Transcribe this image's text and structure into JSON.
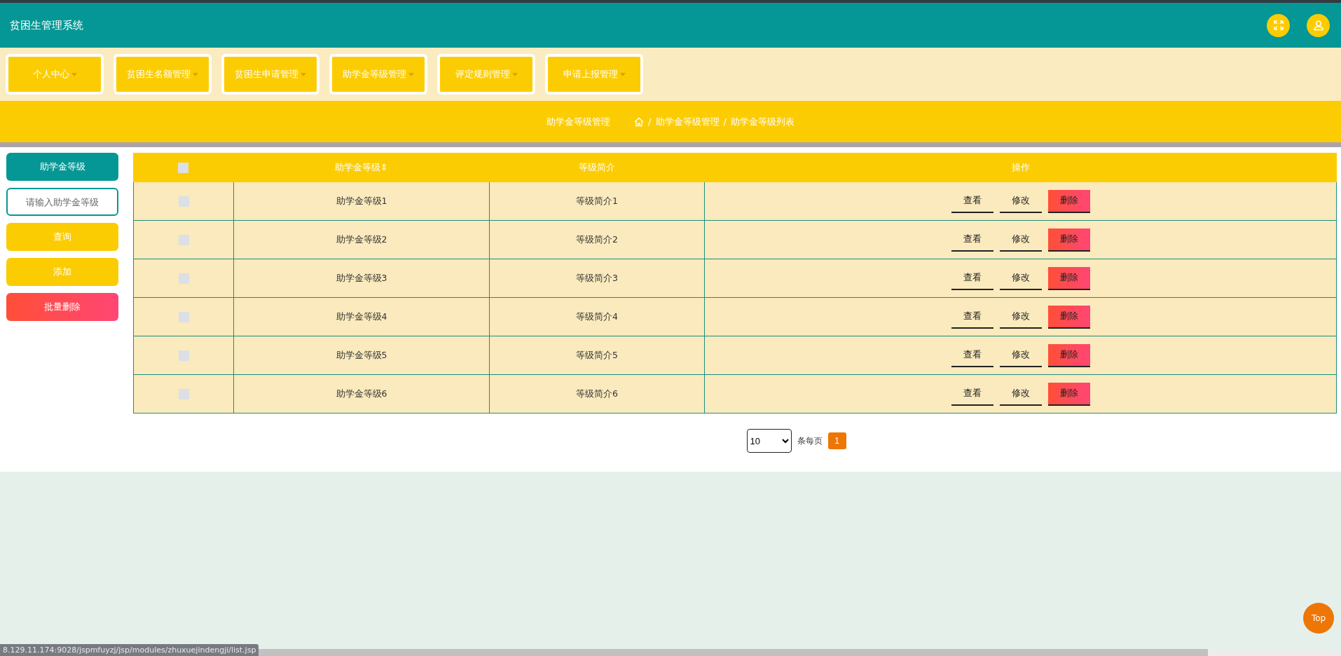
{
  "header": {
    "title": "贫困生管理系统"
  },
  "nav": [
    {
      "label": "个人中心"
    },
    {
      "label": "贫困生名额管理"
    },
    {
      "label": "贫困生申请管理"
    },
    {
      "label": "助学金等级管理"
    },
    {
      "label": "评定规则管理"
    },
    {
      "label": "申请上报管理"
    }
  ],
  "breadcrumb": {
    "title": "助学金等级管理",
    "path": [
      "助学金等级管理",
      "助学金等级列表"
    ],
    "separator": "/"
  },
  "sidebar": {
    "heading": "助学金等级",
    "search": {
      "placeholder": "请输入助学金等级"
    },
    "buttons": [
      {
        "label": "查询",
        "kind": "primary"
      },
      {
        "label": "添加",
        "kind": "primary"
      },
      {
        "label": "批量删除",
        "kind": "danger"
      }
    ]
  },
  "table": {
    "columns": [
      "助学金等级",
      "等级简介",
      "操作"
    ],
    "sort_mark": "⇕",
    "select_all_checked": false,
    "rows": [
      {
        "grade": "助学金等级1",
        "intro": "等级简介1",
        "checked": false,
        "actions": [
          {
            "label": "查看",
            "kind": "plain"
          },
          {
            "label": "修改",
            "kind": "plain"
          },
          {
            "label": "删除",
            "kind": "danger"
          }
        ]
      },
      {
        "grade": "助学金等级2",
        "intro": "等级简介2",
        "checked": false,
        "actions": [
          {
            "label": "查看",
            "kind": "plain"
          },
          {
            "label": "修改",
            "kind": "plain"
          },
          {
            "label": "删除",
            "kind": "danger"
          }
        ]
      },
      {
        "grade": "助学金等级3",
        "intro": "等级简介3",
        "checked": false,
        "actions": [
          {
            "label": "查看",
            "kind": "plain"
          },
          {
            "label": "修改",
            "kind": "plain"
          },
          {
            "label": "删除",
            "kind": "danger"
          }
        ]
      },
      {
        "grade": "助学金等级4",
        "intro": "等级简介4",
        "checked": false,
        "actions": [
          {
            "label": "查看",
            "kind": "plain"
          },
          {
            "label": "修改",
            "kind": "plain"
          },
          {
            "label": "删除",
            "kind": "danger"
          }
        ]
      },
      {
        "grade": "助学金等级5",
        "intro": "等级简介5",
        "checked": false,
        "actions": [
          {
            "label": "查看",
            "kind": "plain"
          },
          {
            "label": "修改",
            "kind": "plain"
          },
          {
            "label": "删除",
            "kind": "danger"
          }
        ]
      },
      {
        "grade": "助学金等级6",
        "intro": "等级简介6",
        "checked": false,
        "actions": [
          {
            "label": "查看",
            "kind": "plain"
          },
          {
            "label": "修改",
            "kind": "plain"
          },
          {
            "label": "删除",
            "kind": "danger"
          }
        ]
      }
    ]
  },
  "pagination": {
    "page_size": "10",
    "per_page_label": "条每页",
    "pages": [
      {
        "label": "1",
        "selected": true
      }
    ]
  },
  "top_button": "Top",
  "status_url": "8.129.11.174:9028/jspmfuyzj/jsp/modules/zhuxuejindengji/list.jsp"
}
